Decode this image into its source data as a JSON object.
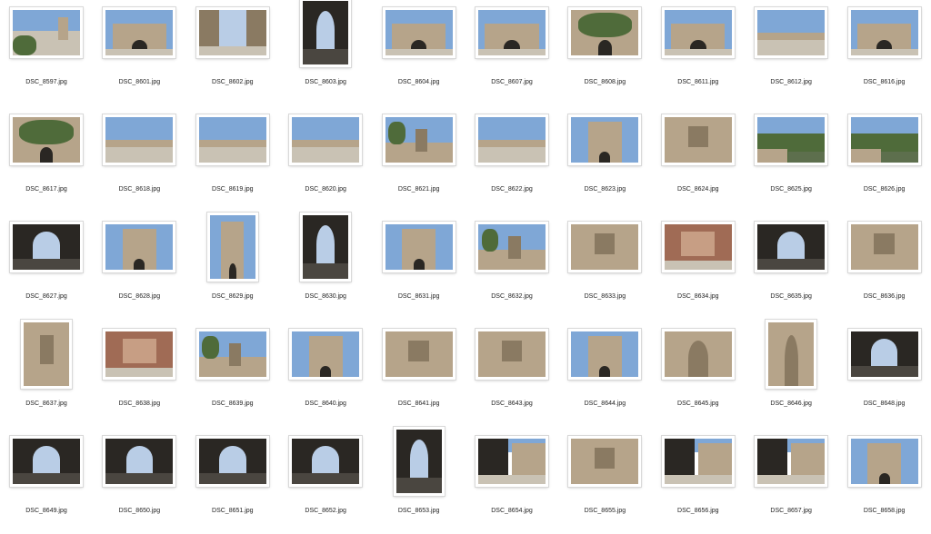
{
  "files": [
    {
      "name": "DSC_8597.jpg",
      "orient": "landscape",
      "scene": "river-gate"
    },
    {
      "name": "DSC_8601.jpg",
      "orient": "landscape",
      "scene": "gate-front"
    },
    {
      "name": "DSC_8602.jpg",
      "orient": "landscape",
      "scene": "tunnel-sky"
    },
    {
      "name": "DSC_8603.jpg",
      "orient": "portrait",
      "scene": "dark-arch"
    },
    {
      "name": "DSC_8604.jpg",
      "orient": "landscape",
      "scene": "gate-front"
    },
    {
      "name": "DSC_8607.jpg",
      "orient": "landscape",
      "scene": "gate-front"
    },
    {
      "name": "DSC_8608.jpg",
      "orient": "landscape",
      "scene": "ivy-wall"
    },
    {
      "name": "DSC_8611.jpg",
      "orient": "landscape",
      "scene": "gate-front"
    },
    {
      "name": "DSC_8612.jpg",
      "orient": "landscape",
      "scene": "bridge"
    },
    {
      "name": "DSC_8616.jpg",
      "orient": "landscape",
      "scene": "gate-front"
    },
    {
      "name": "DSC_8617.jpg",
      "orient": "landscape",
      "scene": "ivy-wall"
    },
    {
      "name": "DSC_8618.jpg",
      "orient": "landscape",
      "scene": "bridge"
    },
    {
      "name": "DSC_8619.jpg",
      "orient": "landscape",
      "scene": "bridge"
    },
    {
      "name": "DSC_8620.jpg",
      "orient": "landscape",
      "scene": "bridge"
    },
    {
      "name": "DSC_8621.jpg",
      "orient": "landscape",
      "scene": "trees-tower"
    },
    {
      "name": "DSC_8622.jpg",
      "orient": "landscape",
      "scene": "bridge"
    },
    {
      "name": "DSC_8623.jpg",
      "orient": "landscape",
      "scene": "tower"
    },
    {
      "name": "DSC_8624.jpg",
      "orient": "landscape",
      "scene": "stone-wall"
    },
    {
      "name": "DSC_8625.jpg",
      "orient": "landscape",
      "scene": "river"
    },
    {
      "name": "DSC_8626.jpg",
      "orient": "landscape",
      "scene": "river"
    },
    {
      "name": "DSC_8627.jpg",
      "orient": "landscape",
      "scene": "dark-arch"
    },
    {
      "name": "DSC_8628.jpg",
      "orient": "landscape",
      "scene": "tower"
    },
    {
      "name": "DSC_8629.jpg",
      "orient": "portrait",
      "scene": "tower"
    },
    {
      "name": "DSC_8630.jpg",
      "orient": "portrait",
      "scene": "dark-arch"
    },
    {
      "name": "DSC_8631.jpg",
      "orient": "landscape",
      "scene": "tower"
    },
    {
      "name": "DSC_8632.jpg",
      "orient": "landscape",
      "scene": "trees-tower"
    },
    {
      "name": "DSC_8633.jpg",
      "orient": "landscape",
      "scene": "stone-wall"
    },
    {
      "name": "DSC_8634.jpg",
      "orient": "landscape",
      "scene": "vault"
    },
    {
      "name": "DSC_8635.jpg",
      "orient": "landscape",
      "scene": "dark-arch"
    },
    {
      "name": "DSC_8636.jpg",
      "orient": "landscape",
      "scene": "stone-wall"
    },
    {
      "name": "DSC_8637.jpg",
      "orient": "portrait",
      "scene": "stone-wall"
    },
    {
      "name": "DSC_8638.jpg",
      "orient": "landscape",
      "scene": "vault"
    },
    {
      "name": "DSC_8639.jpg",
      "orient": "landscape",
      "scene": "trees-tower"
    },
    {
      "name": "DSC_8640.jpg",
      "orient": "landscape",
      "scene": "tower"
    },
    {
      "name": "DSC_8641.jpg",
      "orient": "landscape",
      "scene": "stone-wall"
    },
    {
      "name": "DSC_8643.jpg",
      "orient": "landscape",
      "scene": "stone-wall"
    },
    {
      "name": "DSC_8644.jpg",
      "orient": "landscape",
      "scene": "tower"
    },
    {
      "name": "DSC_8645.jpg",
      "orient": "landscape",
      "scene": "arch-door"
    },
    {
      "name": "DSC_8646.jpg",
      "orient": "portrait",
      "scene": "arch-door"
    },
    {
      "name": "DSC_8648.jpg",
      "orient": "landscape",
      "scene": "dark-arch"
    },
    {
      "name": "DSC_8649.jpg",
      "orient": "landscape",
      "scene": "dark-arch"
    },
    {
      "name": "DSC_8650.jpg",
      "orient": "landscape",
      "scene": "dark-arch"
    },
    {
      "name": "DSC_8651.jpg",
      "orient": "landscape",
      "scene": "dark-arch"
    },
    {
      "name": "DSC_8652.jpg",
      "orient": "landscape",
      "scene": "dark-arch"
    },
    {
      "name": "DSC_8653.jpg",
      "orient": "portrait",
      "scene": "dark-arch"
    },
    {
      "name": "DSC_8654.jpg",
      "orient": "landscape",
      "scene": "alley"
    },
    {
      "name": "DSC_8655.jpg",
      "orient": "landscape",
      "scene": "stone-wall"
    },
    {
      "name": "DSC_8656.jpg",
      "orient": "landscape",
      "scene": "alley"
    },
    {
      "name": "DSC_8657.jpg",
      "orient": "landscape",
      "scene": "alley"
    },
    {
      "name": "DSC_8658.jpg",
      "orient": "landscape",
      "scene": "tower"
    }
  ],
  "colors": {
    "sky": "#7fa7d6",
    "sky_light": "#b9cde6",
    "stone": "#b6a48a",
    "stone_dark": "#8a7a62",
    "shadow": "#2a2723",
    "ground": "#c9c2b4",
    "foliage": "#4f6b3a",
    "water": "#5d6f4d"
  }
}
